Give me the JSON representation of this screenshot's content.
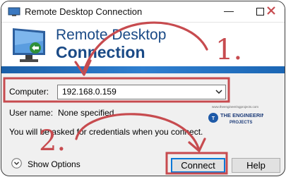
{
  "window": {
    "title": "Remote Desktop Connection",
    "minimize_glyph": "—"
  },
  "banner": {
    "line1": "Remote Desktop",
    "line2": "Connection"
  },
  "form": {
    "computer_label": "Computer:",
    "computer_value": "192.168.0.159",
    "username_label": "User name:",
    "username_value": "None specified",
    "credentials_note": "You will be asked for credentials when you connect."
  },
  "footer": {
    "show_options_label": "Show Options",
    "connect_label": "Connect",
    "help_label": "Help"
  },
  "annotations": {
    "step1": "1.",
    "step2": "2."
  },
  "watermark": {
    "url": "www.theengineeringprojects.com",
    "brand_line1": "THE ENGINEERING",
    "brand_line2": "PROJECTS"
  },
  "colors": {
    "annotation": "#c74b4f",
    "heading": "#1a4a86",
    "banner_strip": "#2f7fd0"
  }
}
